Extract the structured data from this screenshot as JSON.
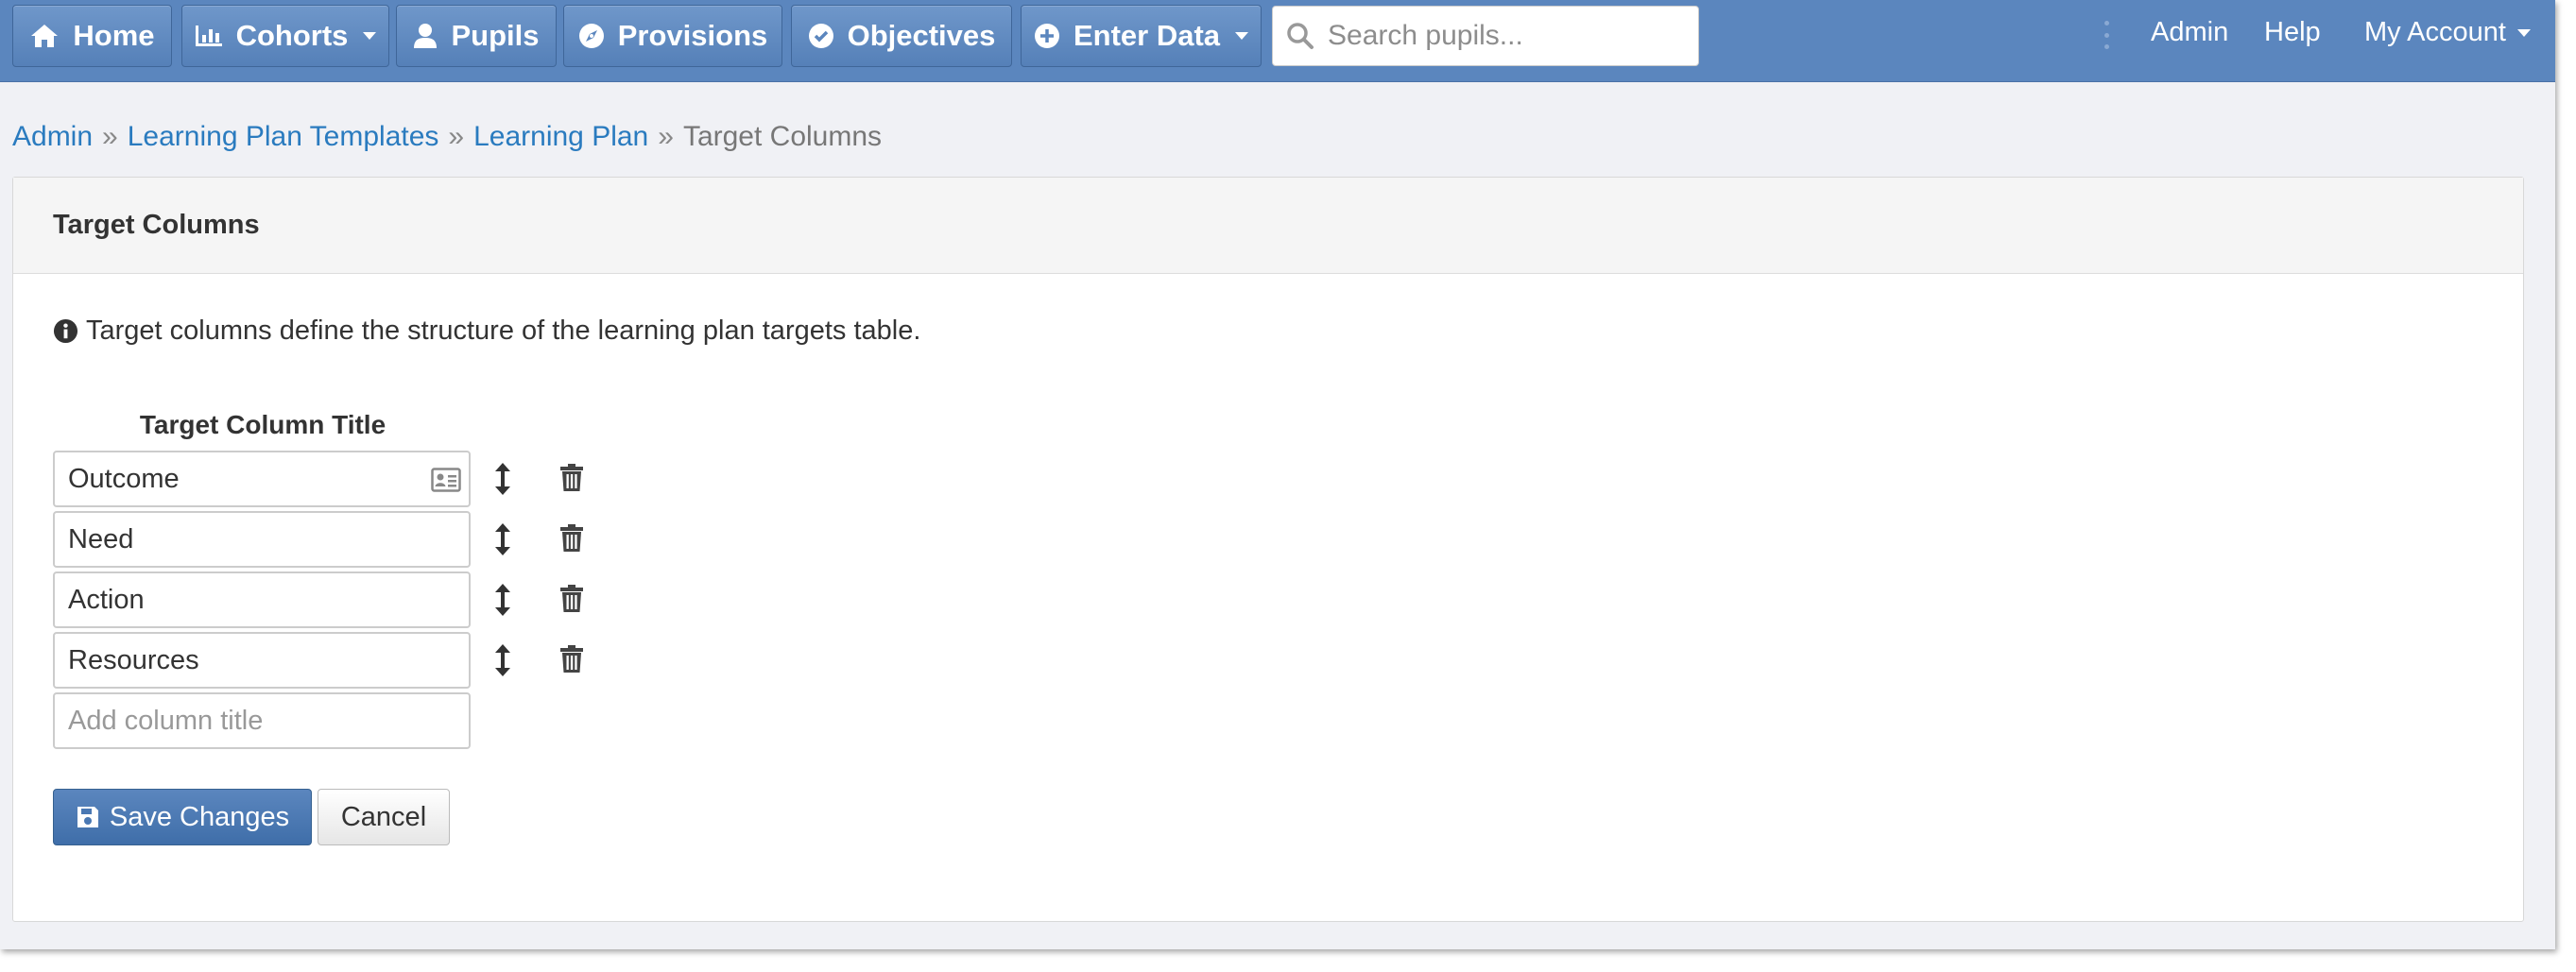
{
  "nav": {
    "home": "Home",
    "cohorts": "Cohorts",
    "pupils": "Pupils",
    "provisions": "Provisions",
    "objectives": "Objectives",
    "enter_data": "Enter Data",
    "search_placeholder": "Search pupils...",
    "admin": "Admin",
    "help": "Help",
    "my_account": "My Account"
  },
  "breadcrumb": {
    "items": [
      "Admin",
      "Learning Plan Templates",
      "Learning Plan"
    ],
    "current": "Target Columns",
    "separator": "»"
  },
  "panel": {
    "title": "Target Columns",
    "info_text": "Target columns define the structure of the learning plan targets table.",
    "column_header": "Target Column Title",
    "rows": [
      {
        "value": "Outcome"
      },
      {
        "value": "Need"
      },
      {
        "value": "Action"
      },
      {
        "value": "Resources"
      }
    ],
    "new_row_placeholder": "Add column title",
    "save_label": "Save Changes",
    "cancel_label": "Cancel"
  },
  "icons": {
    "home": "home-icon",
    "cohorts": "bar-chart-icon",
    "pupils": "user-icon",
    "provisions": "compass-icon",
    "objectives": "check-circle-icon",
    "enter_data": "plus-circle-icon",
    "search": "search-icon",
    "info": "info-circle-icon",
    "card": "address-card-icon",
    "move": "arrows-vertical-icon",
    "trash": "trash-icon",
    "save": "floppy-disk-icon"
  },
  "colors": {
    "navbar": "#5b86be",
    "link": "#2a7bbf",
    "primary_button": "#4a78b3"
  }
}
